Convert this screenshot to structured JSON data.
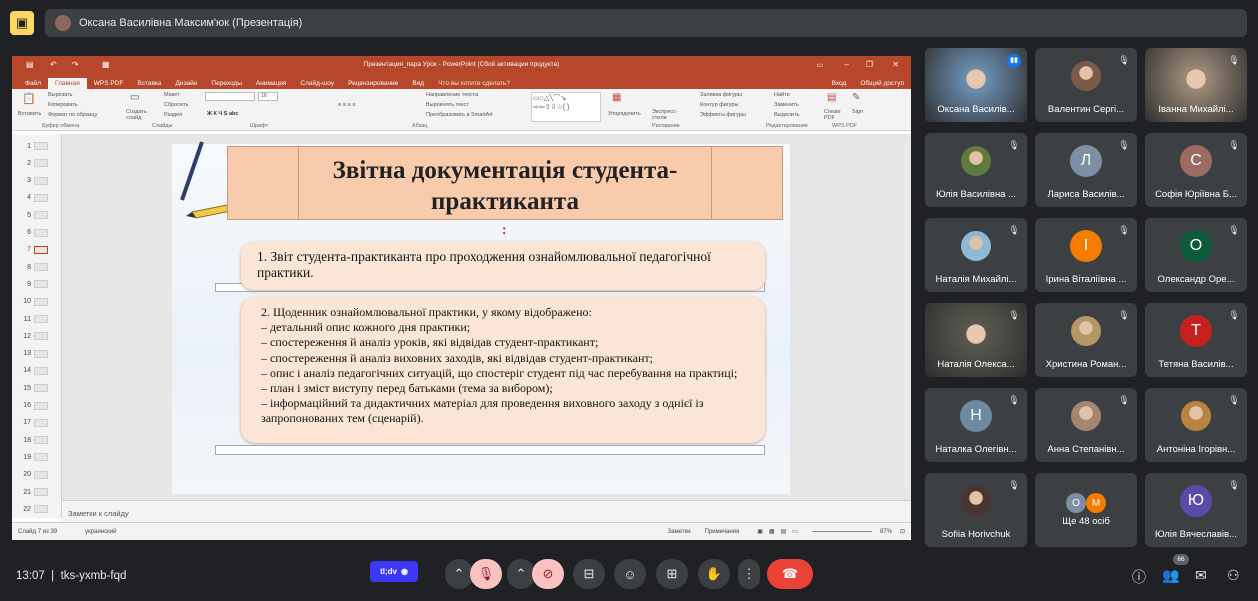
{
  "meet": {
    "presenter_banner": "Оксана Василівна Максим'юк (Презентація)",
    "time": "13:07",
    "meeting_code": "tks-yxmb-fqd",
    "participant_count": "66",
    "tldv_label": "tl;dv"
  },
  "ppt": {
    "window_title": "Презентация_пара Урок - PowerPoint (Сбой активации продукта)",
    "login": "Вход",
    "share": "Общий доступ",
    "tabs": [
      "Файл",
      "Главная",
      "WPS PDF",
      "Вставка",
      "Дизайн",
      "Переходы",
      "Анимация",
      "Слайд-шоу",
      "Рецензирование",
      "Вид"
    ],
    "tell_me": "Что вы хотите сделать?",
    "ribbon": {
      "paste": "Вставить",
      "cut": "Вырезать",
      "copy": "Копировать",
      "format_painter": "Формат по образцу",
      "clipboard": "Буфер обмена",
      "new_slide": "Создать слайд",
      "layout": "Макет",
      "reset": "Сбросить",
      "section": "Раздел",
      "slides": "Слайды",
      "font": "Шрифт",
      "font_size": "16",
      "text_direction": "Направление текста",
      "align_text": "Выровнять текст",
      "smartart": "Преобразовать в SmartArt",
      "paragraph": "Абзац",
      "arrange": "Упорядочить",
      "quick_styles": "Экспресс-стили",
      "shape_fill": "Заливка фигуры",
      "shape_outline": "Контур фигуры",
      "shape_effects": "Эффекты фигуры",
      "drawing": "Рисование",
      "find": "Найти",
      "replace": "Заменить",
      "select": "Выделить",
      "editing": "Редактирование",
      "create_pdf": "Create PDF",
      "sign": "Sign",
      "wps_pdf": "WPS PDF"
    },
    "slide_numbers": [
      "1",
      "2",
      "3",
      "4",
      "5",
      "6",
      "7",
      "8",
      "9",
      "10",
      "11",
      "12",
      "13",
      "14",
      "15",
      "16",
      "17",
      "18",
      "19",
      "20",
      "21",
      "22"
    ],
    "notes_placeholder": "Заметки к слайду",
    "status": {
      "slide_of": "Слайд 7 из 39",
      "language": "украинский",
      "notes": "Заметки",
      "comments": "Примечания",
      "zoom": "87%"
    },
    "slide": {
      "title_line1": "Звітна документація студента-",
      "title_line2": "практиканта",
      "colon": ":",
      "box1": "1. Звіт студента-практиканта про проходження ознайомлювальної педагогічної практики.",
      "box2_lines": [
        "2. Щоденник ознайомлювальної практики, у якому відображено:",
        "– детальний опис кожного дня практики;",
        "– спостереження й аналіз уроків, які відвідав студент-практикант;",
        "– спостереження й аналіз виховних заходів, які відвідав студент-практикант;",
        "– опис і аналіз педагогічних ситуацій, що спостеріг студент під час перебування на практиці;",
        "– план і зміст виступу перед батьками (тема за вибором);",
        "– інформаційний та дидактичних матеріал для проведення виховного заходу з однієї із запропонованих тем (сценарій)."
      ]
    }
  },
  "participants": [
    {
      "name": "Оксана Василів...",
      "kind": "video",
      "color": "#6b8fb0"
    },
    {
      "name": "Валентин Сергі...",
      "kind": "photo",
      "color": "#7a5a48"
    },
    {
      "name": "Іванна Михайлі...",
      "kind": "video",
      "color": "#9c8a78"
    },
    {
      "name": "Юлія Василівна ...",
      "kind": "photo",
      "color": "#5f7a3c"
    },
    {
      "name": "Лариса Василів...",
      "kind": "letter",
      "letter": "Л",
      "color": "#7d8fa3"
    },
    {
      "name": "Софія Юріївна Б...",
      "kind": "letter",
      "letter": "С",
      "color": "#9c6b63"
    },
    {
      "name": "Наталія Михайлі...",
      "kind": "photo",
      "color": "#8fb8d6"
    },
    {
      "name": "Ірина Віталіївна ...",
      "kind": "letter",
      "letter": "І",
      "color": "#f57c00"
    },
    {
      "name": "Олександр Оре...",
      "kind": "letter",
      "letter": "О",
      "color": "#0b5c3a"
    },
    {
      "name": "Наталія Олекса...",
      "kind": "video",
      "color": "#57594e"
    },
    {
      "name": "Христина Роман...",
      "kind": "photo",
      "color": "#b39866"
    },
    {
      "name": "Тетяна Василів...",
      "kind": "letter",
      "letter": "Т",
      "color": "#c5221f"
    },
    {
      "name": "Наталка Олегівн...",
      "kind": "letter",
      "letter": "Н",
      "color": "#6d8aa0"
    },
    {
      "name": "Анна Степанівн...",
      "kind": "photo",
      "color": "#a48670"
    },
    {
      "name": "Антоніна Ігорівн...",
      "kind": "photo",
      "color": "#b9843f"
    },
    {
      "name": "Sofiia Horivchuk",
      "kind": "photo",
      "color": "#4a3430"
    },
    {
      "name": "Ще 48 осіб",
      "kind": "more",
      "color": "#3c4043"
    },
    {
      "name": "Юлія Вячеславів...",
      "kind": "letter",
      "letter": "Ю",
      "color": "#5c4aa8"
    }
  ],
  "more_avatars": [
    "О",
    "М"
  ]
}
